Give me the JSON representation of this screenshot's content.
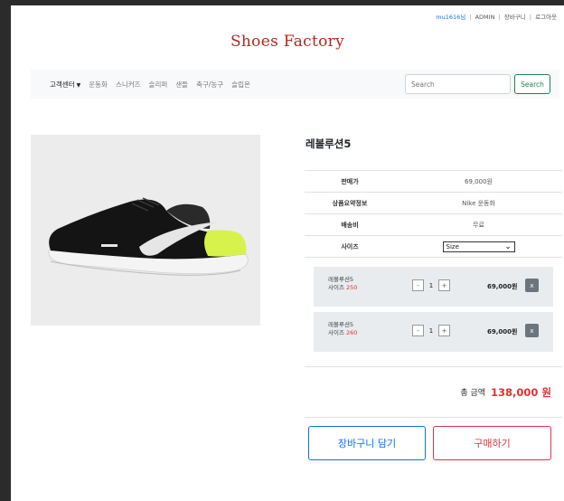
{
  "header": {
    "user_link": "mu1616님",
    "admin_link": "ADMIN",
    "cart_link": "장바구니",
    "logout_link": "로그아웃",
    "separator": "|",
    "brand": "Shoes Factory"
  },
  "nav": {
    "items": [
      {
        "label": "고객센터"
      },
      {
        "label": "운동화"
      },
      {
        "label": "스니커즈"
      },
      {
        "label": "슬리퍼"
      },
      {
        "label": "샌들"
      },
      {
        "label": "축구/농구"
      },
      {
        "label": "슬립온"
      }
    ],
    "search_placeholder": "Search",
    "search_button": "Search"
  },
  "product": {
    "name": "레볼루션5",
    "rows": [
      {
        "label": "판매가",
        "value": "69,000원"
      },
      {
        "label": "상품요약정보",
        "value": "Nike 운동화"
      },
      {
        "label": "배송비",
        "value": "무료"
      }
    ],
    "size_label": "사이즈",
    "size_selected": "Size",
    "colors": {
      "brand": "#b3261e",
      "price": "#e03131",
      "primary": "#0d6efd",
      "danger": "#dc3545"
    }
  },
  "options": [
    {
      "name": "레볼루션5",
      "size_label": "사이즈",
      "size_value": "250",
      "qty": "1",
      "minus": "-",
      "plus": "+",
      "price": "69,000원",
      "remove": "x"
    },
    {
      "name": "레볼루션5",
      "size_label": "사이즈",
      "size_value": "260",
      "qty": "1",
      "minus": "-",
      "plus": "+",
      "price": "69,000원",
      "remove": "x"
    }
  ],
  "total": {
    "label": "총 금액",
    "amount": "138,000 원"
  },
  "actions": {
    "cart_button": "장바구니 담기",
    "buy_button": "구매하기"
  }
}
